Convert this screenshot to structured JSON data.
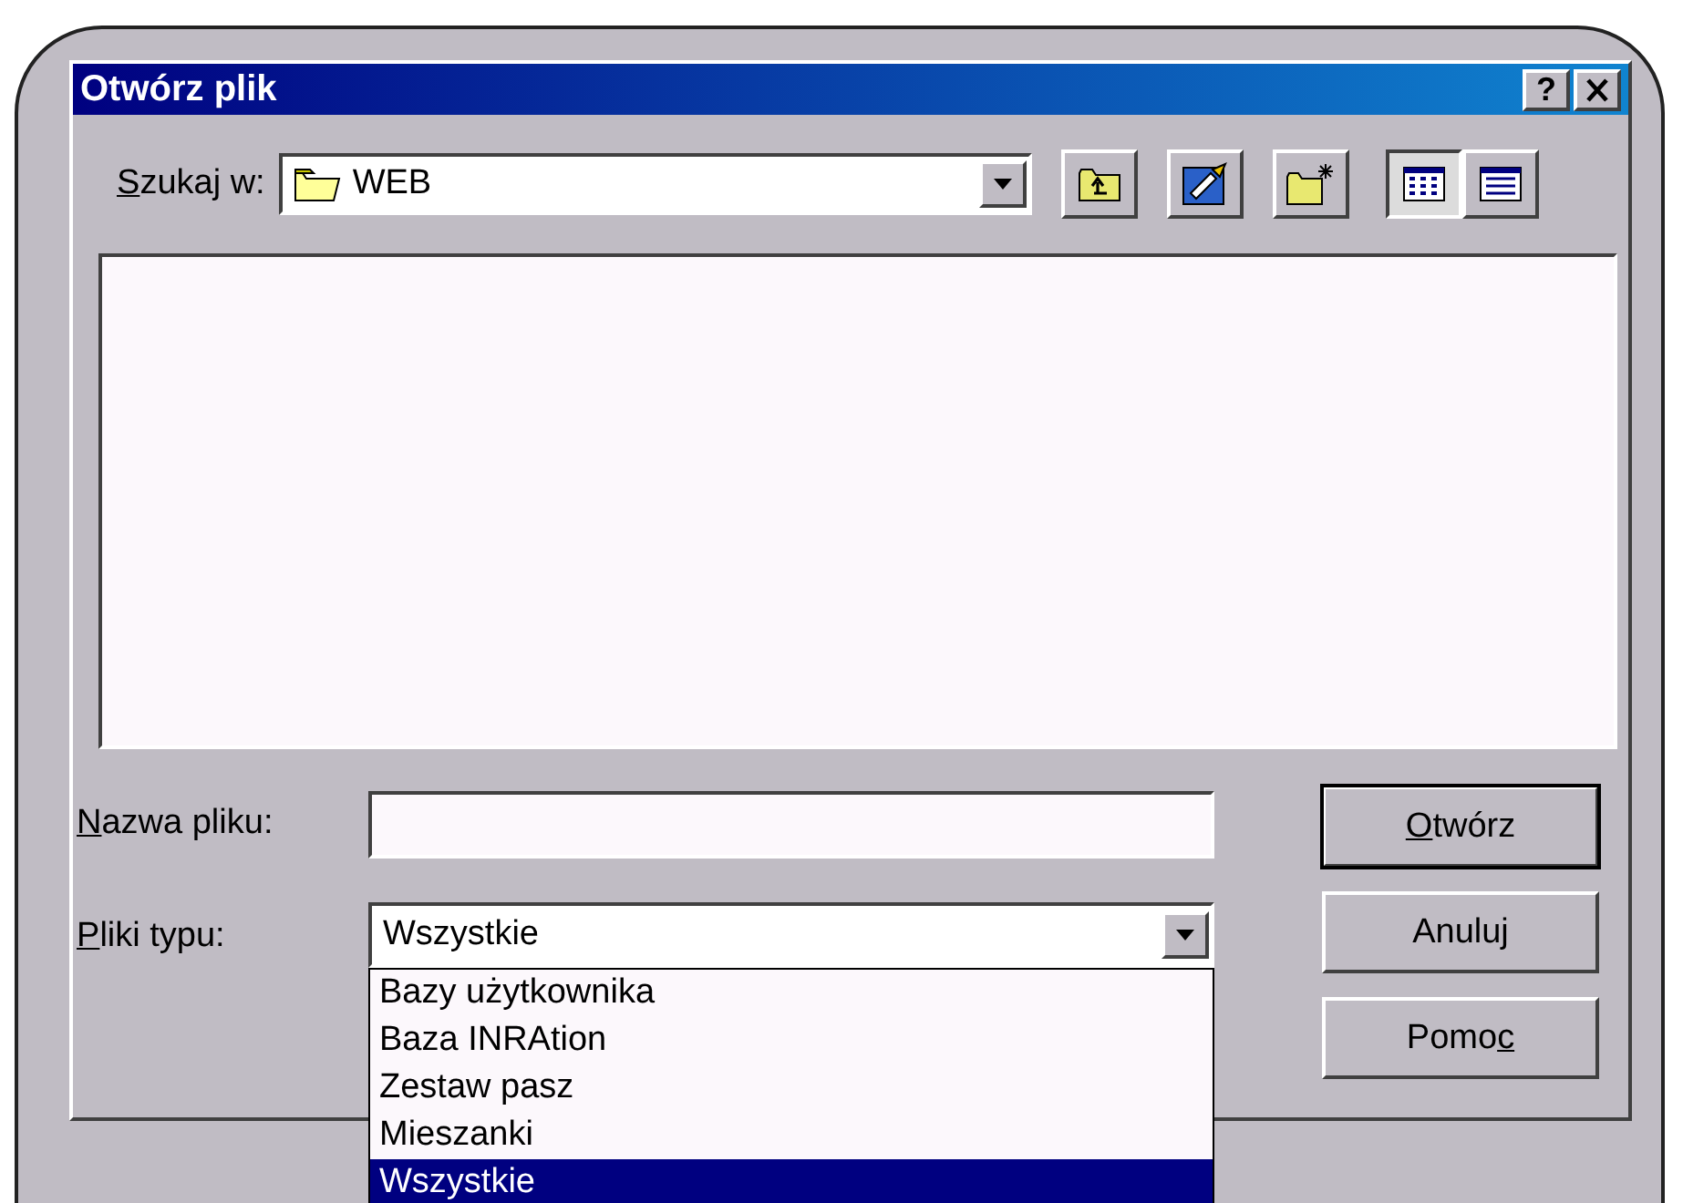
{
  "window": {
    "title": "Otwórz plik",
    "help_button": "?"
  },
  "look_in": {
    "label": {
      "key": "S",
      "post": "zukaj w:"
    },
    "value": "WEB"
  },
  "toolbar": [
    {
      "kind": "up-folder",
      "pressed": false
    },
    {
      "kind": "desktop",
      "pressed": false
    },
    {
      "kind": "new-folder",
      "pressed": false
    },
    {
      "kind": "list-view",
      "pressed": true
    },
    {
      "kind": "details-view",
      "pressed": false
    }
  ],
  "file_name": {
    "label": {
      "key": "N",
      "post": "azwa pliku:"
    }
  },
  "file_type": {
    "label": {
      "key": "P",
      "post": "liki typu:"
    },
    "value": "Wszystkie",
    "expanded": true,
    "options": [
      {
        "text": "Bazy użytkownika",
        "selected": false
      },
      {
        "text": "Baza INRAtion",
        "selected": false
      },
      {
        "text": "Zestaw pasz",
        "selected": false
      },
      {
        "text": "Mieszanki",
        "selected": false
      },
      {
        "text": "Wszystkie",
        "selected": true
      }
    ]
  },
  "buttons": [
    {
      "label": {
        "key": "O",
        "post": "twórz"
      },
      "default": true
    },
    {
      "label": {
        "pre": "Anuluj"
      },
      "default": false
    },
    {
      "label": {
        "pre": "Pomo",
        "key": "c"
      },
      "default": false
    }
  ]
}
